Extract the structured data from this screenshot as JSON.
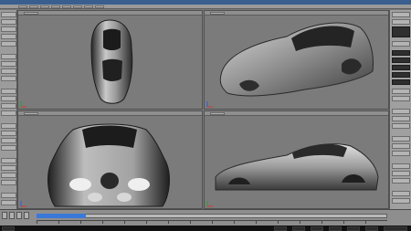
{
  "menu": {
    "items": []
  },
  "viewports": {
    "top": {
      "label": ""
    },
    "perspective": {
      "label": ""
    },
    "front": {
      "label": ""
    },
    "side": {
      "label": ""
    }
  },
  "colors": {
    "menubar": "#3a5f8f",
    "viewport_bg": "#7b7b7b",
    "timeline_marker": "#3a78d8",
    "x_axis": "#d23a3a",
    "y_axis": "#2f9b3a",
    "z_axis": "#2f5bd6"
  },
  "icons": [
    "x-axis-gizmo",
    "y-axis-gizmo",
    "z-axis-gizmo",
    "play-icon",
    "stop-icon",
    "key-icon"
  ]
}
